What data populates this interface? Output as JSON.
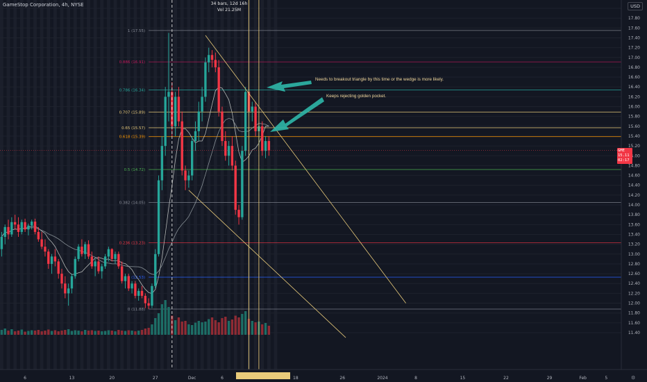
{
  "header": {
    "symbol_line": "GameStop Corporation, 4h, NYSE",
    "measure_line1": "34 bars, 12d 16h",
    "measure_line2": "Vol 21.25M",
    "currency": "USD"
  },
  "annotations": {
    "note1": "Needs to breakout triangle by this time or the wedge is more likely.",
    "note2": "Keeps rejecting golden pocket."
  },
  "price_tag": {
    "symbol": "GME",
    "price": "15.11",
    "countdown": "02:17"
  },
  "range_box_text": "         ",
  "gear_icon": "⚙",
  "colors": {
    "background": "#131722",
    "up": "#26a69a",
    "down": "#f23645",
    "annotation": "#e8ca7a",
    "wedge": "#e8ca7a",
    "arrow": "#2fb7a8",
    "ma_slow": "#9aa3a8",
    "ma_fast": "#cfd2cf",
    "volume_up": "#1d6e66",
    "volume_down": "#8f2b34"
  },
  "chart_data": {
    "type": "candlestick",
    "y_axis": {
      "range": [
        11.3,
        18.05
      ],
      "ticks": [
        "18.00",
        "17.80",
        "17.60",
        "17.40",
        "17.20",
        "17.00",
        "16.80",
        "16.60",
        "16.40",
        "16.20",
        "16.00",
        "15.80",
        "15.60",
        "15.40",
        "15.20",
        "15.00",
        "14.80",
        "14.60",
        "14.40",
        "14.20",
        "14.00",
        "13.80",
        "13.60",
        "13.40",
        "13.20",
        "13.00",
        "12.80",
        "12.60",
        "12.40",
        "12.20",
        "12.00",
        "11.80",
        "11.60",
        "11.40"
      ]
    },
    "x_axis": {
      "labels": [
        {
          "text": "6",
          "bar": 7
        },
        {
          "text": "13",
          "bar": 21
        },
        {
          "text": "20",
          "bar": 33
        },
        {
          "text": "27",
          "bar": 46
        },
        {
          "text": "Dec",
          "bar": 57
        },
        {
          "text": "6",
          "bar": 66
        },
        {
          "text": "18",
          "bar": 88
        },
        {
          "text": "26",
          "bar": 102
        },
        {
          "text": "2024",
          "bar": 114
        },
        {
          "text": "8",
          "bar": 124
        },
        {
          "text": "15",
          "bar": 138
        },
        {
          "text": "22",
          "bar": 151
        },
        {
          "text": "29",
          "bar": 164
        },
        {
          "text": "Feb",
          "bar": 174
        },
        {
          "text": "5",
          "bar": 181
        }
      ]
    },
    "bars_per_view": 186,
    "candles": [
      {
        "o": 13.1,
        "h": 13.45,
        "l": 12.95,
        "c": 13.35
      },
      {
        "o": 13.35,
        "h": 13.6,
        "l": 13.2,
        "c": 13.55
      },
      {
        "o": 13.55,
        "h": 13.7,
        "l": 13.3,
        "c": 13.4
      },
      {
        "o": 13.4,
        "h": 13.75,
        "l": 13.35,
        "c": 13.65
      },
      {
        "o": 13.65,
        "h": 13.8,
        "l": 13.5,
        "c": 13.6
      },
      {
        "o": 13.6,
        "h": 13.75,
        "l": 13.35,
        "c": 13.45
      },
      {
        "o": 13.45,
        "h": 13.7,
        "l": 13.4,
        "c": 13.65
      },
      {
        "o": 13.65,
        "h": 13.72,
        "l": 13.45,
        "c": 13.5
      },
      {
        "o": 13.5,
        "h": 13.62,
        "l": 13.38,
        "c": 13.58
      },
      {
        "o": 13.58,
        "h": 13.7,
        "l": 13.5,
        "c": 13.66
      },
      {
        "o": 13.66,
        "h": 13.72,
        "l": 13.4,
        "c": 13.45
      },
      {
        "o": 13.45,
        "h": 13.55,
        "l": 13.25,
        "c": 13.3
      },
      {
        "o": 13.3,
        "h": 13.45,
        "l": 13.1,
        "c": 13.15
      },
      {
        "o": 13.15,
        "h": 13.3,
        "l": 12.95,
        "c": 13.05
      },
      {
        "o": 13.05,
        "h": 13.1,
        "l": 12.7,
        "c": 12.8
      },
      {
        "o": 12.8,
        "h": 13.0,
        "l": 12.6,
        "c": 12.95
      },
      {
        "o": 12.95,
        "h": 13.1,
        "l": 12.75,
        "c": 12.85
      },
      {
        "o": 12.85,
        "h": 12.9,
        "l": 12.5,
        "c": 12.6
      },
      {
        "o": 12.6,
        "h": 12.7,
        "l": 12.3,
        "c": 12.4
      },
      {
        "o": 12.4,
        "h": 12.55,
        "l": 12.1,
        "c": 12.2
      },
      {
        "o": 12.2,
        "h": 12.4,
        "l": 11.95,
        "c": 12.3
      },
      {
        "o": 12.3,
        "h": 12.6,
        "l": 12.2,
        "c": 12.55
      },
      {
        "o": 12.55,
        "h": 12.95,
        "l": 12.5,
        "c": 12.9
      },
      {
        "o": 12.9,
        "h": 13.2,
        "l": 12.85,
        "c": 13.15
      },
      {
        "o": 13.15,
        "h": 13.3,
        "l": 12.95,
        "c": 13.0
      },
      {
        "o": 13.0,
        "h": 13.25,
        "l": 12.9,
        "c": 13.2
      },
      {
        "o": 13.2,
        "h": 13.28,
        "l": 12.9,
        "c": 12.95
      },
      {
        "o": 12.95,
        "h": 13.05,
        "l": 12.7,
        "c": 12.75
      },
      {
        "o": 12.75,
        "h": 12.9,
        "l": 12.55,
        "c": 12.85
      },
      {
        "o": 12.85,
        "h": 12.95,
        "l": 12.6,
        "c": 12.65
      },
      {
        "o": 12.65,
        "h": 12.8,
        "l": 12.5,
        "c": 12.75
      },
      {
        "o": 12.75,
        "h": 13.0,
        "l": 12.7,
        "c": 12.95
      },
      {
        "o": 12.95,
        "h": 13.15,
        "l": 12.85,
        "c": 13.1
      },
      {
        "o": 13.1,
        "h": 13.12,
        "l": 12.85,
        "c": 12.9
      },
      {
        "o": 12.9,
        "h": 13.05,
        "l": 12.8,
        "c": 13.0
      },
      {
        "o": 13.0,
        "h": 13.05,
        "l": 12.7,
        "c": 12.75
      },
      {
        "o": 12.75,
        "h": 12.85,
        "l": 12.4,
        "c": 12.45
      },
      {
        "o": 12.45,
        "h": 12.6,
        "l": 12.3,
        "c": 12.55
      },
      {
        "o": 12.55,
        "h": 12.6,
        "l": 12.25,
        "c": 12.3
      },
      {
        "o": 12.3,
        "h": 12.45,
        "l": 12.2,
        "c": 12.4
      },
      {
        "o": 12.4,
        "h": 12.45,
        "l": 12.1,
        "c": 12.15
      },
      {
        "o": 12.15,
        "h": 12.3,
        "l": 12.05,
        "c": 12.25
      },
      {
        "o": 12.25,
        "h": 12.35,
        "l": 12.1,
        "c": 12.15
      },
      {
        "o": 12.15,
        "h": 12.2,
        "l": 11.9,
        "c": 12.0
      },
      {
        "o": 12.0,
        "h": 12.1,
        "l": 11.88,
        "c": 11.95
      },
      {
        "o": 11.95,
        "h": 12.4,
        "l": 11.9,
        "c": 12.35
      },
      {
        "o": 12.35,
        "h": 13.1,
        "l": 12.3,
        "c": 13.0
      },
      {
        "o": 13.0,
        "h": 14.6,
        "l": 12.95,
        "c": 14.5
      },
      {
        "o": 14.5,
        "h": 15.4,
        "l": 14.3,
        "c": 15.2
      },
      {
        "o": 15.2,
        "h": 16.4,
        "l": 15.0,
        "c": 16.2
      },
      {
        "o": 16.2,
        "h": 17.5,
        "l": 15.7,
        "c": 16.3
      },
      {
        "o": 16.3,
        "h": 16.5,
        "l": 15.4,
        "c": 15.6
      },
      {
        "o": 15.6,
        "h": 16.3,
        "l": 15.4,
        "c": 16.2
      },
      {
        "o": 16.2,
        "h": 16.4,
        "l": 15.6,
        "c": 15.7
      },
      {
        "o": 15.7,
        "h": 15.9,
        "l": 14.6,
        "c": 14.7
      },
      {
        "o": 14.7,
        "h": 14.8,
        "l": 14.3,
        "c": 14.5
      },
      {
        "o": 14.5,
        "h": 14.7,
        "l": 14.35,
        "c": 14.6
      },
      {
        "o": 14.6,
        "h": 15.4,
        "l": 14.5,
        "c": 15.3
      },
      {
        "o": 15.3,
        "h": 15.7,
        "l": 15.1,
        "c": 15.5
      },
      {
        "o": 15.5,
        "h": 16.1,
        "l": 15.3,
        "c": 15.9
      },
      {
        "o": 15.9,
        "h": 16.4,
        "l": 15.7,
        "c": 16.2
      },
      {
        "o": 16.2,
        "h": 17.0,
        "l": 16.1,
        "c": 16.9
      },
      {
        "o": 16.9,
        "h": 17.2,
        "l": 16.7,
        "c": 17.05
      },
      {
        "o": 17.05,
        "h": 17.15,
        "l": 16.8,
        "c": 16.95
      },
      {
        "o": 16.95,
        "h": 17.1,
        "l": 16.7,
        "c": 16.8
      },
      {
        "o": 16.8,
        "h": 16.95,
        "l": 15.8,
        "c": 15.9
      },
      {
        "o": 15.9,
        "h": 16.0,
        "l": 15.2,
        "c": 15.3
      },
      {
        "o": 15.3,
        "h": 15.5,
        "l": 14.9,
        "c": 15.0
      },
      {
        "o": 15.0,
        "h": 15.3,
        "l": 14.8,
        "c": 15.2
      },
      {
        "o": 15.2,
        "h": 15.4,
        "l": 14.7,
        "c": 14.8
      },
      {
        "o": 14.8,
        "h": 14.9,
        "l": 13.8,
        "c": 13.9
      },
      {
        "o": 13.9,
        "h": 14.0,
        "l": 13.6,
        "c": 13.75
      },
      {
        "o": 13.75,
        "h": 15.2,
        "l": 13.7,
        "c": 15.1
      },
      {
        "o": 15.1,
        "h": 16.4,
        "l": 15.0,
        "c": 16.3
      },
      {
        "o": 16.3,
        "h": 16.4,
        "l": 15.8,
        "c": 15.9
      },
      {
        "o": 15.9,
        "h": 16.1,
        "l": 15.7,
        "c": 16.0
      },
      {
        "o": 16.0,
        "h": 16.1,
        "l": 15.4,
        "c": 15.5
      },
      {
        "o": 15.5,
        "h": 15.7,
        "l": 15.2,
        "c": 15.6
      },
      {
        "o": 15.6,
        "h": 15.7,
        "l": 15.0,
        "c": 15.1
      },
      {
        "o": 15.1,
        "h": 15.4,
        "l": 14.95,
        "c": 15.3
      },
      {
        "o": 15.3,
        "h": 15.4,
        "l": 15.0,
        "c": 15.11
      }
    ],
    "volume": {
      "max": 100,
      "values": [
        14,
        18,
        12,
        16,
        10,
        12,
        15,
        9,
        11,
        13,
        12,
        14,
        10,
        12,
        15,
        11,
        13,
        10,
        12,
        14,
        16,
        11,
        13,
        12,
        10,
        14,
        12,
        13,
        11,
        12,
        10,
        11,
        13,
        12,
        10,
        14,
        12,
        11,
        13,
        12,
        10,
        12,
        14,
        18,
        20,
        30,
        48,
        62,
        88,
        100,
        80,
        55,
        42,
        50,
        38,
        40,
        30,
        28,
        35,
        40,
        36,
        38,
        45,
        50,
        42,
        36,
        48,
        52,
        40,
        44,
        55,
        50,
        60,
        68,
        46,
        40,
        36,
        38,
        30,
        34,
        26
      ]
    },
    "moving_averages": [
      {
        "color_key": "ma_fast",
        "period": 8
      },
      {
        "color_key": "ma_slow",
        "period": 21
      }
    ],
    "fib_levels": [
      {
        "label": "1 (17.55)",
        "value": 17.55,
        "color": "#8a8e99"
      },
      {
        "label": "0.886 (16.91)",
        "value": 16.91,
        "color": "#c2185b"
      },
      {
        "label": "0.786 (16.34)",
        "value": 16.34,
        "color": "#26a69a"
      },
      {
        "label": "0.707 (15.89)",
        "value": 15.89,
        "color": "#e8ca7a"
      },
      {
        "label": "0.65 (15.57)",
        "value": 15.57,
        "color": "#e8ca7a"
      },
      {
        "label": "0.618 (15.39)",
        "value": 15.39,
        "color": "#ff9800"
      },
      {
        "label": "0.5 (14.72)",
        "value": 14.72,
        "color": "#4caf50"
      },
      {
        "label": "0.382 (14.05)",
        "value": 14.05,
        "color": "#8a8e99"
      },
      {
        "label": "0.236 (13.23)",
        "value": 13.23,
        "color": "#f23645"
      },
      {
        "label": "0 (12.53)",
        "value": 12.53,
        "color": "#2962ff"
      },
      {
        "label": "0 (11.88)",
        "value": 11.88,
        "color": "#8a8e99"
      }
    ],
    "wedge_lines": [
      {
        "p1": {
          "bar": 61,
          "price": 17.45
        },
        "p2": {
          "bar": 121,
          "price": 12.0
        }
      },
      {
        "p1": {
          "bar": 56,
          "price": 14.3
        },
        "p2": {
          "bar": 103,
          "price": 11.3
        }
      }
    ],
    "vertical_markers": [
      {
        "bar": 51,
        "style": "dashed",
        "color": "#e6e6e6"
      },
      {
        "bar": 74,
        "style": "solid",
        "color": "#e8ca7a"
      },
      {
        "bar": 77,
        "style": "solid",
        "color": "#e8ca7a"
      }
    ]
  }
}
